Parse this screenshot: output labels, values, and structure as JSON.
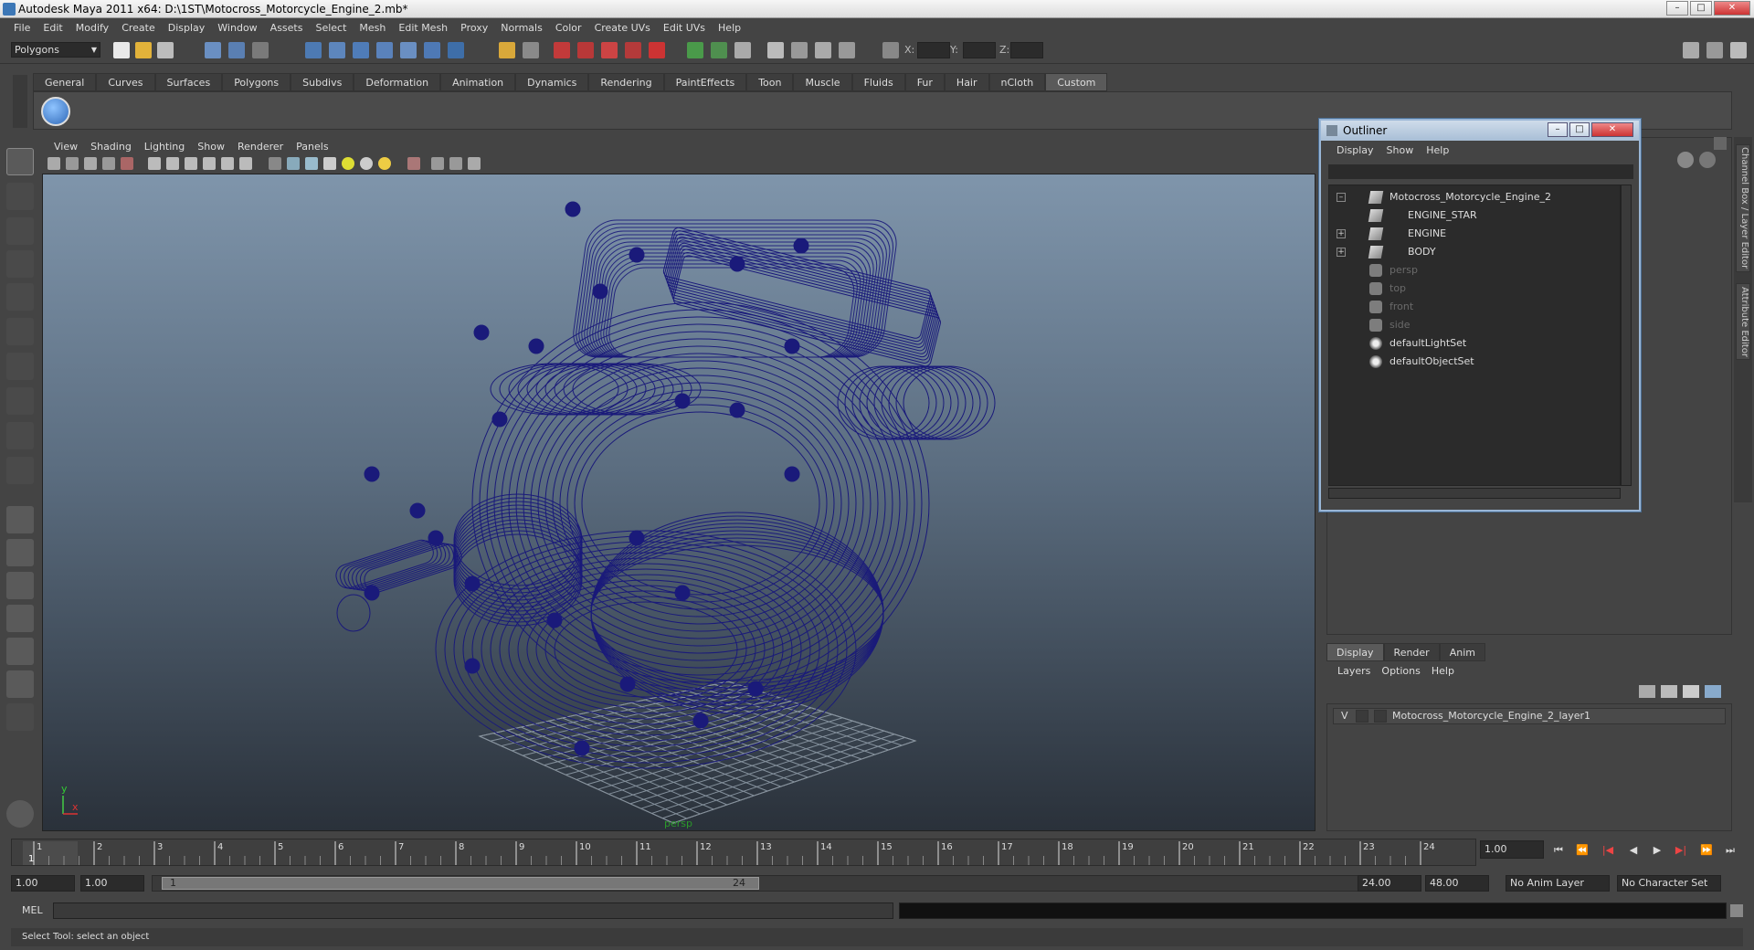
{
  "window": {
    "title": "Autodesk Maya 2011 x64: D:\\1ST\\Motocross_Motorcycle_Engine_2.mb*",
    "minimize": "–",
    "maximize": "□",
    "close": "✕"
  },
  "menubar": [
    "File",
    "Edit",
    "Modify",
    "Create",
    "Display",
    "Window",
    "Assets",
    "Select",
    "Mesh",
    "Edit Mesh",
    "Proxy",
    "Normals",
    "Color",
    "Create UVs",
    "Edit UVs",
    "Help"
  ],
  "statusline": {
    "mode": "Polygons",
    "x_label": "X:",
    "y_label": "Y:",
    "z_label": "Z:"
  },
  "shelf": {
    "tabs": [
      "General",
      "Curves",
      "Surfaces",
      "Polygons",
      "Subdivs",
      "Deformation",
      "Animation",
      "Dynamics",
      "Rendering",
      "PaintEffects",
      "Toon",
      "Muscle",
      "Fluids",
      "Fur",
      "Hair",
      "nCloth",
      "Custom"
    ],
    "active_tab": "Custom"
  },
  "viewport": {
    "menu": [
      "View",
      "Shading",
      "Lighting",
      "Show",
      "Renderer",
      "Panels"
    ],
    "camera_label": "persp",
    "axis_y": "y",
    "axis_x": "x",
    "wire_color": "#1a1a7a"
  },
  "outliner": {
    "title": "Outliner",
    "menu": [
      "Display",
      "Show",
      "Help"
    ],
    "items": [
      {
        "label": "Motocross_Motorcycle_Engine_2",
        "icon": "transform-icon",
        "indent": 0,
        "expander": "–",
        "dim": false
      },
      {
        "label": "ENGINE_STAR",
        "icon": "curve-icon",
        "indent": 1,
        "expander": "",
        "dim": false
      },
      {
        "label": "ENGINE",
        "icon": "transform-icon",
        "indent": 1,
        "expander": "+",
        "dim": false
      },
      {
        "label": "BODY",
        "icon": "transform-icon",
        "indent": 1,
        "expander": "+",
        "dim": false
      },
      {
        "label": "persp",
        "icon": "camera-icon",
        "indent": 0,
        "expander": "",
        "dim": true
      },
      {
        "label": "top",
        "icon": "camera-icon",
        "indent": 0,
        "expander": "",
        "dim": true
      },
      {
        "label": "front",
        "icon": "camera-icon",
        "indent": 0,
        "expander": "",
        "dim": true
      },
      {
        "label": "side",
        "icon": "camera-icon",
        "indent": 0,
        "expander": "",
        "dim": true
      },
      {
        "label": "defaultLightSet",
        "icon": "set-icon",
        "indent": 0,
        "expander": "",
        "dim": false
      },
      {
        "label": "defaultObjectSet",
        "icon": "set-icon",
        "indent": 0,
        "expander": "",
        "dim": false
      }
    ]
  },
  "side_tabs": [
    "Channel Box / Layer Editor",
    "Attribute Editor"
  ],
  "layers": {
    "tabs": [
      "Display",
      "Render",
      "Anim"
    ],
    "active_tab": "Display",
    "menu": [
      "Layers",
      "Options",
      "Help"
    ],
    "rows": [
      {
        "visible": "V",
        "name": "Motocross_Motorcycle_Engine_2_layer1"
      }
    ]
  },
  "timeline": {
    "ticks": [
      "1",
      "2",
      "3",
      "4",
      "5",
      "6",
      "7",
      "8",
      "9",
      "10",
      "11",
      "12",
      "13",
      "14",
      "15",
      "16",
      "17",
      "18",
      "19",
      "20",
      "21",
      "22",
      "23",
      "24"
    ],
    "current_frame_marker": "1",
    "current_time": "1.00"
  },
  "range": {
    "start_time": "1.00",
    "playback_start": "1.00",
    "slider_start": "1",
    "slider_end": "24",
    "playback_end": "24.00",
    "end_time": "48.00",
    "anim_layer": "No Anim Layer",
    "character_set": "No Character Set"
  },
  "command": {
    "label": "MEL"
  },
  "help_line": "Select Tool: select an object"
}
